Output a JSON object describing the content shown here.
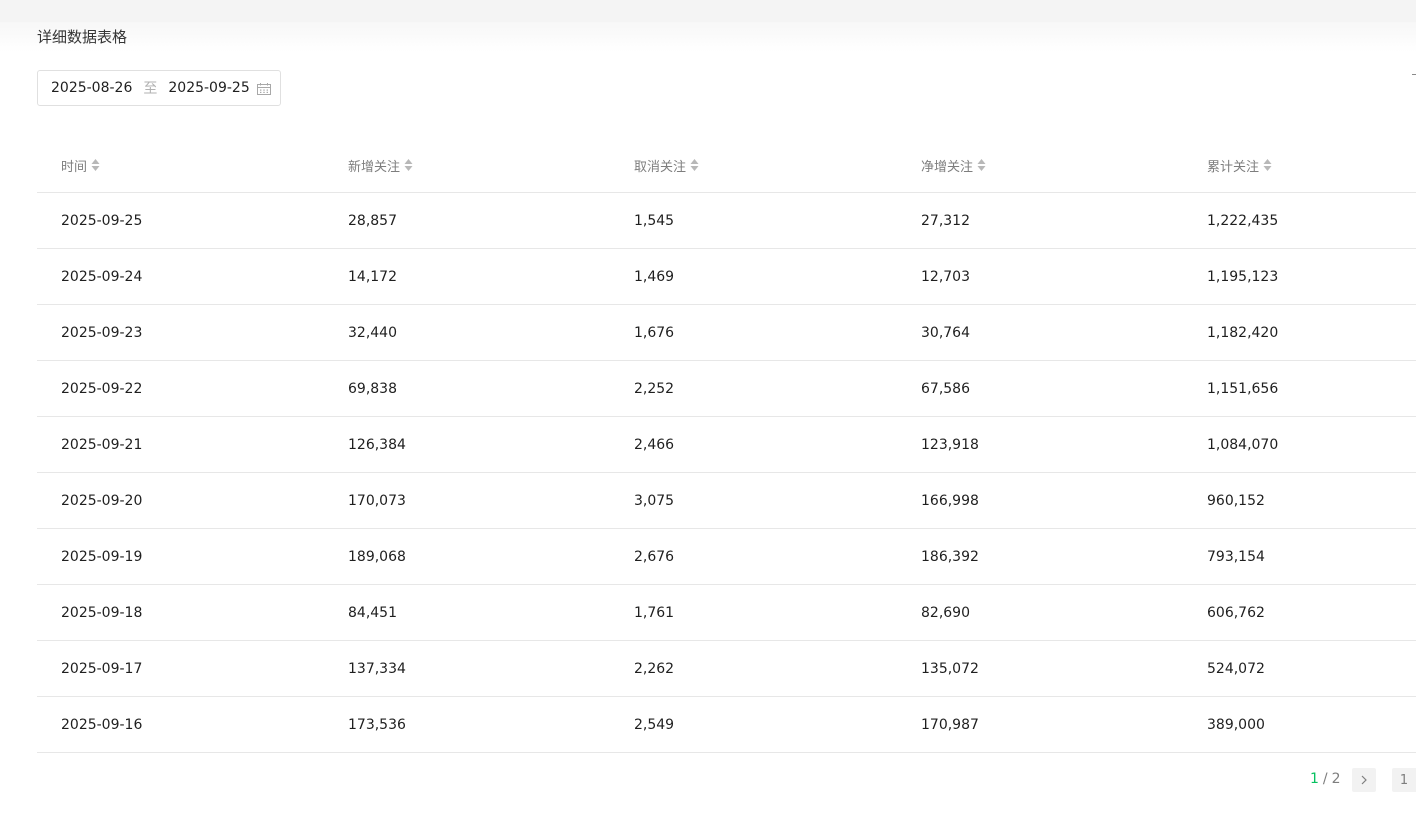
{
  "section": {
    "title": "详细数据表格"
  },
  "date_range": {
    "start": "2025-08-26",
    "separator": "至",
    "end": "2025-09-25",
    "icon": "calendar-icon"
  },
  "table": {
    "columns": [
      "时间",
      "新增关注",
      "取消关注",
      "净增关注",
      "累计关注"
    ],
    "sort_icon": "sort-icon",
    "rows": [
      [
        "2025-09-25",
        "28,857",
        "1,545",
        "27,312",
        "1,222,435"
      ],
      [
        "2025-09-24",
        "14,172",
        "1,469",
        "12,703",
        "1,195,123"
      ],
      [
        "2025-09-23",
        "32,440",
        "1,676",
        "30,764",
        "1,182,420"
      ],
      [
        "2025-09-22",
        "69,838",
        "2,252",
        "67,586",
        "1,151,656"
      ],
      [
        "2025-09-21",
        "126,384",
        "2,466",
        "123,918",
        "1,084,070"
      ],
      [
        "2025-09-20",
        "170,073",
        "3,075",
        "166,998",
        "960,152"
      ],
      [
        "2025-09-19",
        "189,068",
        "2,676",
        "186,392",
        "793,154"
      ],
      [
        "2025-09-18",
        "84,451",
        "1,761",
        "82,690",
        "606,762"
      ],
      [
        "2025-09-17",
        "137,334",
        "2,262",
        "135,072",
        "524,072"
      ],
      [
        "2025-09-16",
        "173,536",
        "2,549",
        "170,987",
        "389,000"
      ]
    ]
  },
  "pagination": {
    "current": "1",
    "slash": "/",
    "total": "2",
    "jump_value": "1",
    "next_icon": "chevron-right-icon"
  },
  "colors": {
    "accent": "#07c160",
    "border": "#e7e7e7",
    "muted_text": "#7e7e7e"
  }
}
